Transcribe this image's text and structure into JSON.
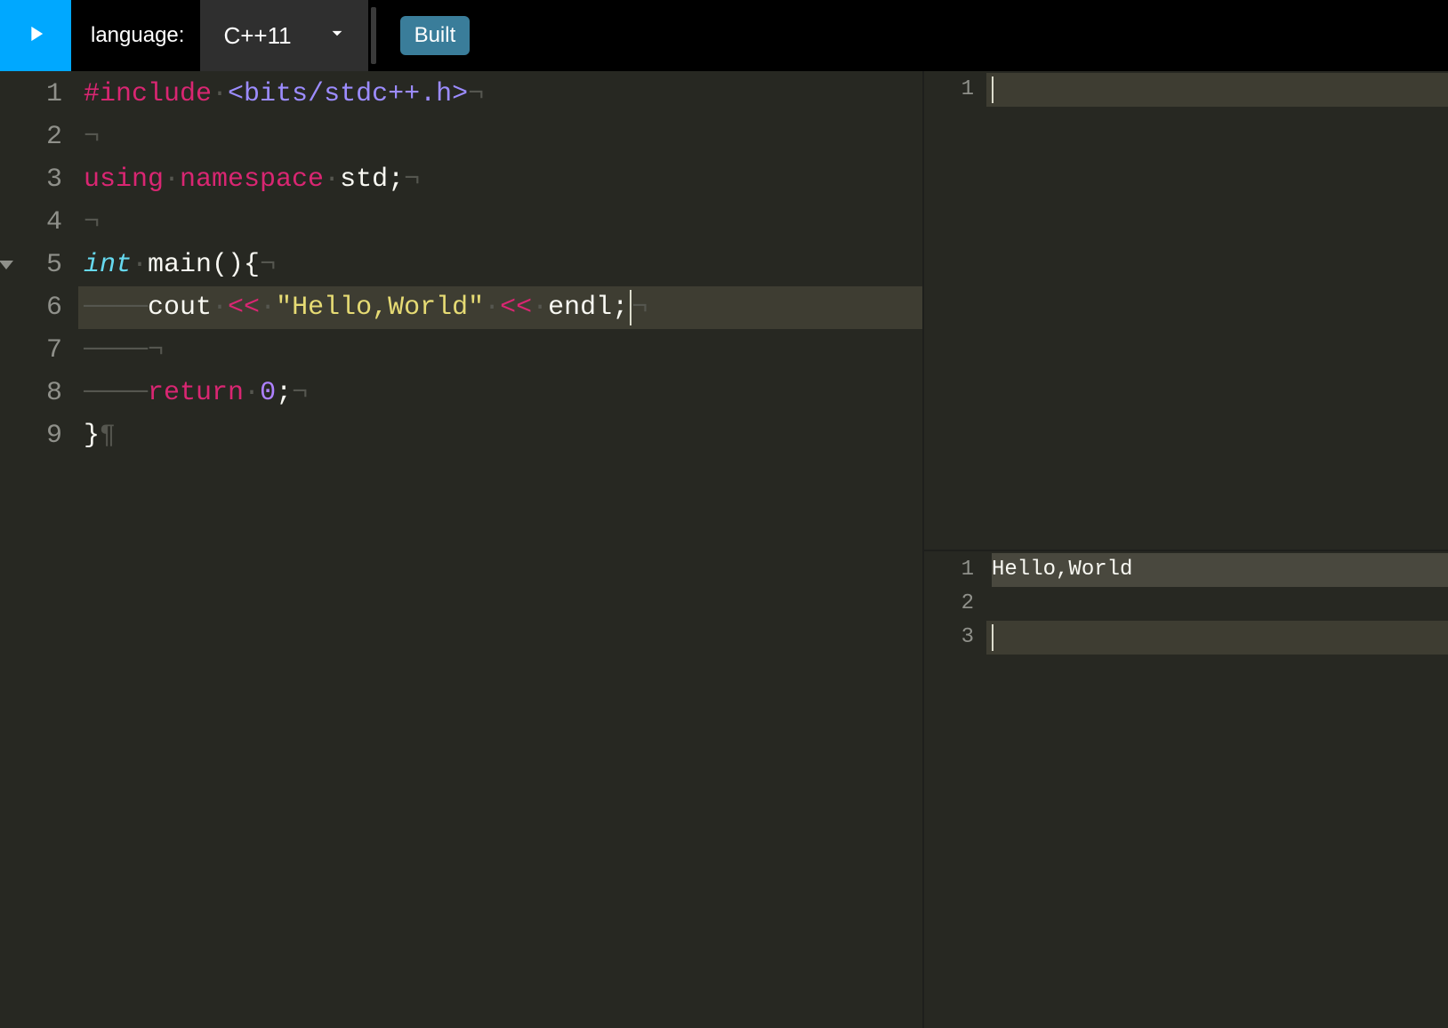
{
  "toolbar": {
    "run_icon": "play-icon",
    "language_label": "language:",
    "language_selected": "C++11",
    "built_label": "Built"
  },
  "editor": {
    "highlighted_line": 6,
    "fold_line": 5,
    "lines": [
      {
        "n": 1,
        "segments": [
          {
            "cls": "tok-preproc",
            "t": "#include"
          },
          {
            "cls": "invis",
            "t": "·"
          },
          {
            "cls": "tok-include-path",
            "t": "<bits/stdc++.h>"
          },
          {
            "cls": "invis",
            "t": "¬"
          }
        ]
      },
      {
        "n": 2,
        "segments": [
          {
            "cls": "invis",
            "t": "¬"
          }
        ]
      },
      {
        "n": 3,
        "segments": [
          {
            "cls": "tok-keyword",
            "t": "using"
          },
          {
            "cls": "invis",
            "t": "·"
          },
          {
            "cls": "tok-namespace",
            "t": "namespace"
          },
          {
            "cls": "invis",
            "t": "·"
          },
          {
            "cls": "tok-ident",
            "t": "std"
          },
          {
            "cls": "tok-punc",
            "t": ";"
          },
          {
            "cls": "invis",
            "t": "¬"
          }
        ]
      },
      {
        "n": 4,
        "segments": [
          {
            "cls": "invis",
            "t": "¬"
          }
        ]
      },
      {
        "n": 5,
        "segments": [
          {
            "cls": "tok-storage",
            "t": "int"
          },
          {
            "cls": "invis",
            "t": "·"
          },
          {
            "cls": "tok-func",
            "t": "main"
          },
          {
            "cls": "tok-punc",
            "t": "(){"
          },
          {
            "cls": "invis",
            "t": "¬"
          }
        ]
      },
      {
        "n": 6,
        "segments": [
          {
            "cls": "invis",
            "t": "────"
          },
          {
            "cls": "tok-ident",
            "t": "cout"
          },
          {
            "cls": "invis",
            "t": "·"
          },
          {
            "cls": "tok-op",
            "t": "<<"
          },
          {
            "cls": "invis",
            "t": "·"
          },
          {
            "cls": "tok-string",
            "t": "\"Hello,World\""
          },
          {
            "cls": "invis",
            "t": "·"
          },
          {
            "cls": "tok-op",
            "t": "<<"
          },
          {
            "cls": "invis",
            "t": "·"
          },
          {
            "cls": "tok-ident",
            "t": "endl"
          },
          {
            "cls": "tok-punc",
            "t": ";"
          },
          {
            "cls": "cursor",
            "t": ""
          },
          {
            "cls": "invis",
            "t": "¬"
          }
        ]
      },
      {
        "n": 7,
        "segments": [
          {
            "cls": "invis",
            "t": "────¬"
          }
        ]
      },
      {
        "n": 8,
        "segments": [
          {
            "cls": "invis",
            "t": "────"
          },
          {
            "cls": "tok-keyword",
            "t": "return"
          },
          {
            "cls": "invis",
            "t": "·"
          },
          {
            "cls": "tok-num",
            "t": "0"
          },
          {
            "cls": "tok-punc",
            "t": ";"
          },
          {
            "cls": "invis",
            "t": "¬"
          }
        ]
      },
      {
        "n": 9,
        "segments": [
          {
            "cls": "tok-punc",
            "t": "}"
          },
          {
            "cls": "invis",
            "t": "¶"
          }
        ]
      }
    ]
  },
  "input_panel": {
    "lines": [
      {
        "n": 1,
        "highlight": true,
        "t": "",
        "cursor": true
      }
    ]
  },
  "output_panel": {
    "lines": [
      {
        "n": 1,
        "t": "Hello,World",
        "hl": true
      },
      {
        "n": 2,
        "t": ""
      },
      {
        "n": 3,
        "highlight": true,
        "t": "",
        "cursor": true
      }
    ]
  }
}
